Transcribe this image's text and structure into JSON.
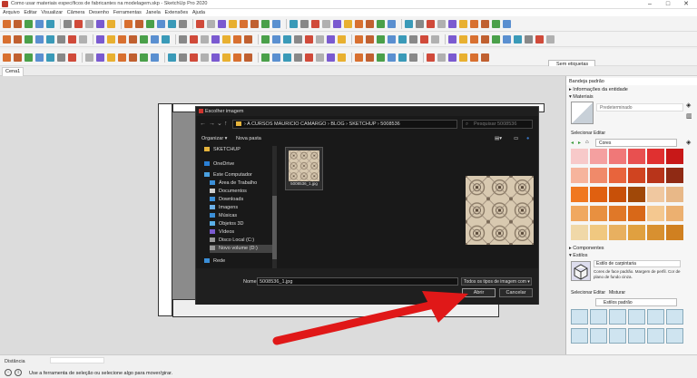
{
  "window": {
    "title": "Como usar materiais específicos de fabricantes na modelagem.skp - SketchUp Pro 2020"
  },
  "menu": [
    "Arquivo",
    "Editar",
    "Visualizar",
    "Câmera",
    "Desenho",
    "Ferramentas",
    "Janela",
    "Extensões",
    "Ajuda"
  ],
  "tabs": {
    "scene": "Cena1"
  },
  "toolbar": {
    "tags_dropdown": "Sem etiquetas"
  },
  "dialog": {
    "title": "Escolher imagem",
    "path": [
      "A CURSOS MAURICIO CAMARGO",
      "BLOG",
      "SKETCHUP",
      "5008536"
    ],
    "search_placeholder": "Pesquisar 5008536",
    "organize": "Organizar ▾",
    "new_folder": "Nova pasta",
    "nav": [
      "SKETCHUP",
      "OneDrive",
      "Este Computador",
      "Área de Trabalho",
      "Documentos",
      "Downloads",
      "Imagens",
      "Músicas",
      "Objetos 3D",
      "Vídeos",
      "Disco Local (C:)",
      "Novo volume (D:)",
      "Rede"
    ],
    "file": {
      "name": "5008536_1.jpg"
    },
    "name_label": "Nome:",
    "name_value": "5008536_1.jpg",
    "filetype": "Todos os tipos de imagem com",
    "open": "Abrir",
    "cancel": "Cancelar"
  },
  "tray": {
    "title": "Bandeja padrão",
    "entity_info": "Informações da entidade",
    "materials": "Materiais",
    "material_name": "Predeterminado",
    "tab_select": "Selecionar",
    "tab_edit": "Editar",
    "category": "Cores",
    "swatch_colors": [
      "#f7c9c9",
      "#f4a0a0",
      "#f07878",
      "#e85050",
      "#e03030",
      "#c81818",
      "#f6b49c",
      "#f08a6a",
      "#e8643c",
      "#d04420",
      "#b8341a",
      "#8f2a14",
      "#f07820",
      "#e06010",
      "#c85008",
      "#a04808",
      "#f0c8a0",
      "#e8b888",
      "#f0a860",
      "#e89040",
      "#e07828",
      "#d86818",
      "#f4c890",
      "#ecb070",
      "#f0d8a8",
      "#f0c880",
      "#e8b060",
      "#e0a040",
      "#d89030",
      "#d08020"
    ],
    "components": "Componentes",
    "styles": "Estilos",
    "style_name": "Estilo de carpintaria",
    "style_desc": "Cores de face padrão. Margem de perfil. Cor de plano de fundo cinza.",
    "style_tabs": [
      "Selecionar",
      "Editar",
      "Misturar"
    ],
    "style_category": "Estilos padrão"
  },
  "status": {
    "distance_label": "Distância",
    "hint": "Use a ferramenta de seleção ou selecione algo para mover/girar."
  },
  "colors": {
    "arrow": "#e01818",
    "accent": "#3a78c8"
  }
}
